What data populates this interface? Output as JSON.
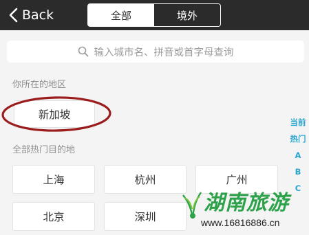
{
  "header": {
    "back_label": "Back",
    "tabs": [
      {
        "label": "全部",
        "active": true
      },
      {
        "label": "境外",
        "active": false
      }
    ]
  },
  "search": {
    "placeholder": "输入城市名、拼音或首字母查询"
  },
  "current_region": {
    "title": "你所在的地区",
    "city": "新加坡"
  },
  "hot_destinations": {
    "title": "全部热门目的地",
    "cities": [
      "上海",
      "杭州",
      "广州",
      "北京",
      "深圳"
    ]
  },
  "index_bar": [
    "当前",
    "热门",
    "A",
    "B",
    "C"
  ],
  "watermark": {
    "title": "湖南旅游",
    "url": "www.16816886.cn"
  },
  "colors": {
    "navbar": "#2b2b2b",
    "index_accent": "#2aa6cf",
    "annotation": "#9b1c1c",
    "watermark_green": "#2da24a"
  }
}
